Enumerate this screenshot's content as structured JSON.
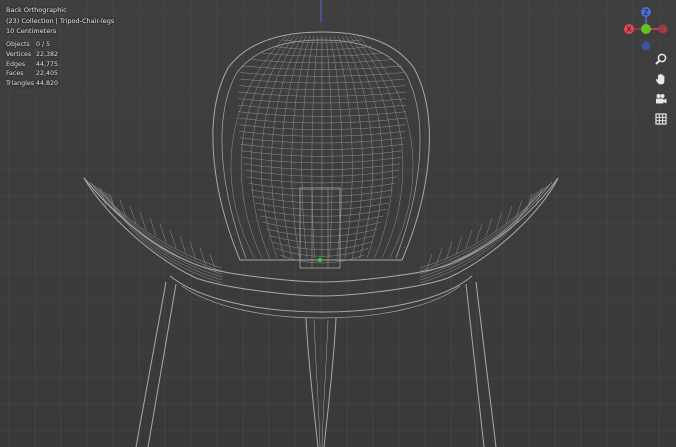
{
  "viewport": {
    "view_name": "Back Orthographic",
    "collection_line": "(23) Collection | Tripod-Chair-legs",
    "scale_label": "10 Centimeters"
  },
  "stats": [
    {
      "label": "Objects",
      "value": "0 / 5"
    },
    {
      "label": "Vertices",
      "value": "22,382"
    },
    {
      "label": "Edges",
      "value": "44,775"
    },
    {
      "label": "Faces",
      "value": "22,405"
    },
    {
      "label": "Triangles",
      "value": "44,820"
    }
  ],
  "gizmo": {
    "axes": {
      "z": "Z",
      "x": "X",
      "y": "Y"
    },
    "colors": {
      "x": "#e0484f",
      "y": "#61c224",
      "z": "#4b6fd6",
      "neg_x": "#a33c42",
      "neg_z": "#3e53a0"
    }
  },
  "tools": [
    {
      "icon": "zoom-icon"
    },
    {
      "icon": "hand-pan-icon"
    },
    {
      "icon": "camera-view-icon"
    },
    {
      "icon": "grid-perspective-icon"
    }
  ],
  "colors": {
    "background": "#3d3d3d",
    "grid_line": "#4a4a4a",
    "wire": "#a9a9a9",
    "origin_dot": "#3bd13b",
    "vertical_axis": "#5566cc"
  }
}
